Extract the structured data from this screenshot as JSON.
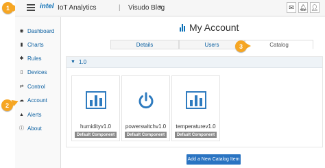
{
  "header": {
    "logo": "intel",
    "app_title": "IoT Analytics",
    "separator": "|",
    "account_name": "Visudo Blog",
    "caret": "▾",
    "icons": [
      "mail-icon",
      "bell-icon",
      "user-icon"
    ]
  },
  "sidebar": {
    "items": [
      {
        "label": "Dashboard",
        "icon": "dashboard-icon"
      },
      {
        "label": "Charts",
        "icon": "charts-icon"
      },
      {
        "label": "Rules",
        "icon": "rules-icon"
      },
      {
        "label": "Devices",
        "icon": "devices-icon"
      },
      {
        "label": "Control",
        "icon": "control-icon"
      },
      {
        "label": "Account",
        "icon": "account-icon"
      },
      {
        "label": "Alerts",
        "icon": "alerts-icon"
      },
      {
        "label": "About",
        "icon": "about-icon"
      }
    ]
  },
  "callouts": [
    "1",
    "2",
    "3"
  ],
  "page": {
    "title": "My Account",
    "tabs": [
      "Details",
      "Users",
      "Catalog"
    ],
    "active_tab": "Catalog"
  },
  "catalog": {
    "version_label": "1.0",
    "components": [
      {
        "name": "humidityv1.0",
        "icon": "bar-chart-icon",
        "badge": "Default Component"
      },
      {
        "name": "powerswitchv1.0",
        "icon": "power-icon",
        "badge": "Default Component"
      },
      {
        "name": "temperaturev1.0",
        "icon": "bar-chart-icon",
        "badge": "Default Component"
      }
    ],
    "add_button": "Add a New Catalog Item"
  },
  "colors": {
    "accent": "#2a74c2",
    "callout": "#f6a623",
    "icon_blue": "#2e7bbf"
  }
}
